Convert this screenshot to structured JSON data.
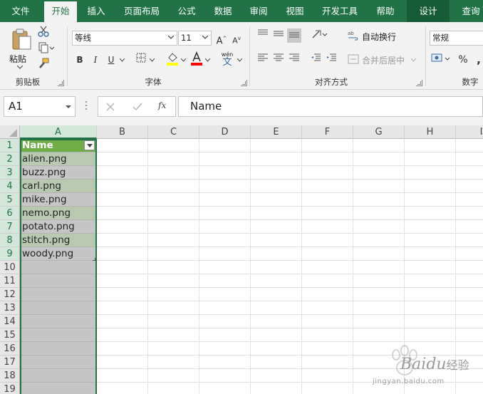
{
  "tabs": [
    "文件",
    "开始",
    "插入",
    "页面布局",
    "公式",
    "数据",
    "审阅",
    "视图",
    "开发工具",
    "帮助",
    "设计",
    "查询"
  ],
  "active_tab": "开始",
  "ribbon": {
    "clipboard": {
      "paste_label": "粘贴",
      "group_label": "剪贴板"
    },
    "font": {
      "name": "等线",
      "size": "11",
      "bold": "B",
      "italic": "I",
      "underline": "U",
      "phonetic": "wén",
      "phonetic_char": "文",
      "grow": "A",
      "shrink": "A",
      "group_label": "字体",
      "fill_color": "#ffff00",
      "font_color": "#ff0000"
    },
    "alignment": {
      "wrap_text": "自动换行",
      "merge_center": "合并后居中",
      "group_label": "对齐方式"
    },
    "number": {
      "format": "常规",
      "percent": "%",
      "group_label": "数字"
    }
  },
  "formula_bar": {
    "name_box": "A1",
    "fx": "fx",
    "formula": "Name"
  },
  "sheet": {
    "columns": [
      "A",
      "B",
      "C",
      "D",
      "E",
      "F",
      "G",
      "H",
      "I"
    ],
    "rows": [
      "1",
      "2",
      "3",
      "4",
      "5",
      "6",
      "7",
      "8",
      "9",
      "10",
      "11",
      "12",
      "13",
      "14",
      "15",
      "16",
      "17",
      "18",
      "19"
    ],
    "column_a": [
      "Name",
      "alien.png",
      "buzz.png",
      "carl.png",
      "mike.png",
      "nemo.png",
      "potato.png",
      "stitch.png",
      "woody.png"
    ]
  },
  "colors": {
    "excel_green": "#217346",
    "table_header": "#70ad47",
    "band": "#b9c9b0",
    "selection": "#c6c6c6"
  },
  "watermark": {
    "brand": "Baidu",
    "brand_tail": "经验",
    "url": "jingyan.baidu.com"
  }
}
